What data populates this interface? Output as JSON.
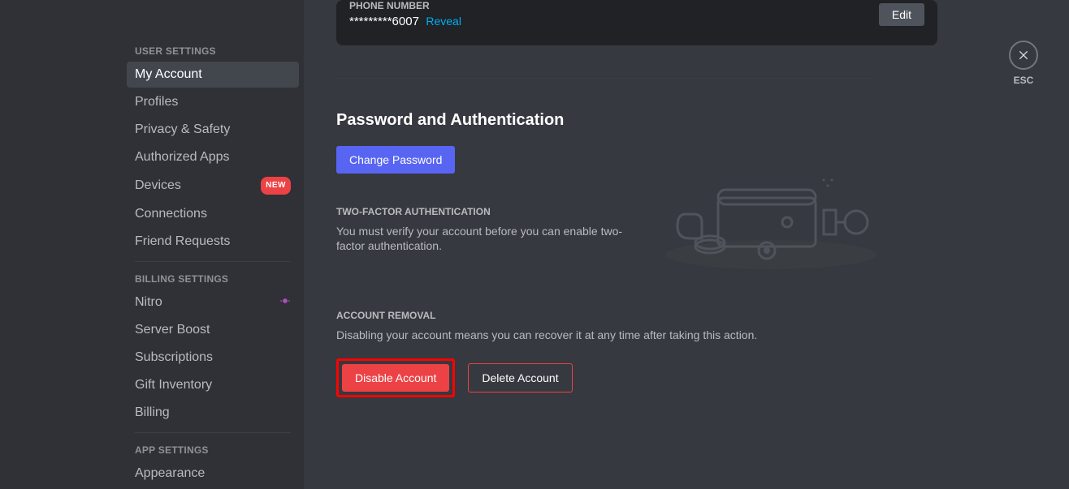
{
  "sidebar": {
    "headers": {
      "user": "USER SETTINGS",
      "billing": "BILLING SETTINGS",
      "app": "APP SETTINGS"
    },
    "user_items": [
      {
        "label": "My Account"
      },
      {
        "label": "Profiles"
      },
      {
        "label": "Privacy & Safety"
      },
      {
        "label": "Authorized Apps"
      },
      {
        "label": "Devices"
      },
      {
        "label": "Connections"
      },
      {
        "label": "Friend Requests"
      }
    ],
    "new_badge": "NEW",
    "billing_items": [
      {
        "label": "Nitro"
      },
      {
        "label": "Server Boost"
      },
      {
        "label": "Subscriptions"
      },
      {
        "label": "Gift Inventory"
      },
      {
        "label": "Billing"
      }
    ],
    "app_items": [
      {
        "label": "Appearance"
      }
    ]
  },
  "content": {
    "phone": {
      "label": "PHONE NUMBER",
      "value": "*********6007",
      "reveal": "Reveal",
      "edit": "Edit"
    },
    "password": {
      "title": "Password and Authentication",
      "change": "Change Password",
      "twofa_header": "TWO-FACTOR AUTHENTICATION",
      "twofa_desc": "You must verify your account before you can enable two-factor authentication."
    },
    "removal": {
      "header": "ACCOUNT REMOVAL",
      "desc": "Disabling your account means you can recover it at any time after taking this action.",
      "disable": "Disable Account",
      "delete": "Delete Account"
    }
  },
  "close": {
    "esc": "ESC"
  }
}
